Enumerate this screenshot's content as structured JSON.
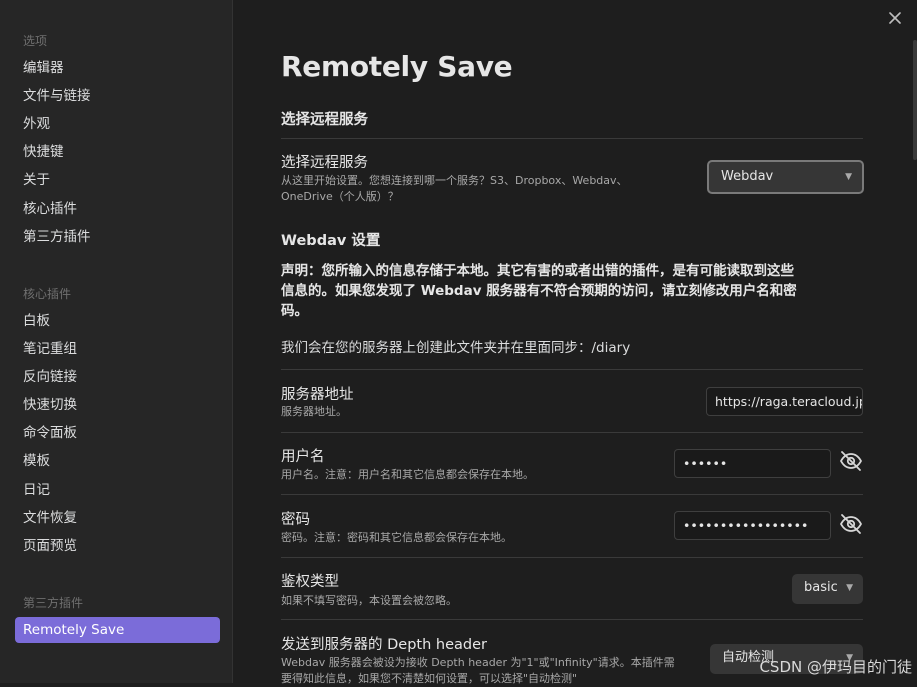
{
  "sidebar": {
    "options_title": "选项",
    "options_items": [
      "编辑器",
      "文件与链接",
      "外观",
      "快捷键",
      "关于",
      "核心插件",
      "第三方插件"
    ],
    "core_title": "核心插件",
    "core_items": [
      "白板",
      "笔记重组",
      "反向链接",
      "快速切换",
      "命令面板",
      "模板",
      "日记",
      "文件恢复",
      "页面预览"
    ],
    "third_title": "第三方插件",
    "third_items": [
      "Remotely Save"
    ]
  },
  "main": {
    "title": "Remotely Save",
    "section_remote": "选择远程服务",
    "remote_service": {
      "name": "选择远程服务",
      "desc_line1": "从这里开始设置。您想连接到哪一个服务？S3、Dropbox、Webdav、",
      "desc_line2": "OneDrive（个人版）？",
      "value": "Webdav"
    },
    "section_webdav": "Webdav 设置",
    "warning_line1": "声明：您所输入的信息存储于本地。其它有害的或者出错的插件，是有可能读取到这些",
    "warning_line2": "信息的。如果您发现了 Webdav 服务器有不符合预期的访问，请立刻修改用户名和密",
    "warning_line3": "码。",
    "folder_note": "我们会在您的服务器上创建此文件夹并在里面同步：/diary",
    "server": {
      "name": "服务器地址",
      "desc": "服务器地址。",
      "value": "https://raga.teracloud.jp/"
    },
    "username": {
      "name": "用户名",
      "desc": "用户名。注意：用户名和其它信息都会保存在本地。",
      "value": "••••••"
    },
    "password": {
      "name": "密码",
      "desc": "密码。注意：密码和其它信息都会保存在本地。",
      "value": "•••••••••••••••••"
    },
    "auth": {
      "name": "鉴权类型",
      "desc": "如果不填写密码，本设置会被忽略。",
      "value": "basic"
    },
    "depth": {
      "name": "发送到服务器的 Depth header",
      "desc_line1": "Webdav 服务器会被设为接收 Depth header 为\"1\"或\"Infinity\"请求。本插件需",
      "desc_line2": "要得知此信息，如果您不清楚如何设置，可以选择\"自动检测\"",
      "value": "自动检测"
    }
  },
  "watermark": "CSDN @伊玛目的门徒",
  "icons": {
    "close": "close-icon",
    "eye": "eye-off-icon",
    "chevron": "chevron-down-icon"
  },
  "colors": {
    "accent": "#7b6cd9",
    "background": "#1e1e1e",
    "sidebar": "#262626"
  }
}
